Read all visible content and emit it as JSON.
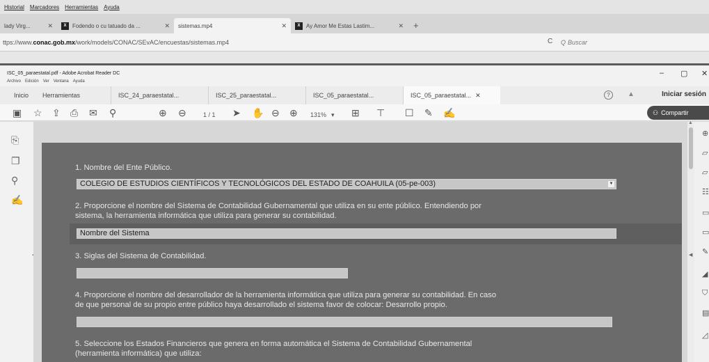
{
  "browser": {
    "menu": [
      "Historial",
      "Marcadores",
      "Herramientas",
      "Ayuda"
    ],
    "tabs": [
      {
        "label": "lady Virg...",
        "favicon": ""
      },
      {
        "label": "Fodendo o cu tatuado da ...",
        "favicon": "X"
      },
      {
        "label": "sistemas.mp4",
        "favicon": ""
      },
      {
        "label": "Ay Amor Me Estas Lastim...",
        "favicon": "X"
      }
    ],
    "url_prefix": "ttps://www.",
    "url_domain": "conac.gob.mx",
    "url_path": "/work/models/CONAC/SEvAC/encuestas/sistemas.mp4",
    "search_placeholder": "Buscar"
  },
  "acrobat": {
    "window_title": "ISC_05_paraestatal.pdf - Adobe Acrobat Reader DC",
    "menu": [
      "Archivo",
      "Edición",
      "Ver",
      "Ventana",
      "Ayuda"
    ],
    "nav": {
      "home": "Inicio",
      "tools": "Herramientas"
    },
    "doc_tabs": [
      {
        "label": "ISC_24_paraestatal..."
      },
      {
        "label": "ISC_25_paraestatal..."
      },
      {
        "label": "ISC_05_paraestatal..."
      },
      {
        "label": "ISC_05_paraestatal..."
      }
    ],
    "signin": "Iniciar sesión",
    "page_indicator": "1 / 1",
    "zoom": "131%",
    "share_label": "Compartir"
  },
  "form": {
    "q1": "1. Nombre del Ente Público.",
    "q1_value": "COLEGIO DE ESTUDIOS CIENTÍFICOS Y TECNOLÓGICOS DEL ESTADO DE COAHUILA (05-pe-003)",
    "q2_line1": "2. Proporcione el nombre del Sistema de Contabilidad Gubernamental que utiliza en su ente público. Entendiendo por",
    "q2_line2": "sistema, la herramienta informática que utiliza para generar su contabilidad.",
    "q2_value": "Nombre del Sistema",
    "q3": "3. Siglas del Sistema de Contabilidad.",
    "q4_line1": "4. Proporcione el nombre del desarrollador de la herramienta informática que utiliza para generar su contabilidad. En caso",
    "q4_line2": "de que personal de su propio entre público haya desarrollado el sistema favor de colocar: Desarrollo propio.",
    "q5_line1": "5. Seleccione los Estados Financieros que genera en forma automática el Sistema de Contabilidad Gubernamental",
    "q5_line2": "(herramienta informática) que utiliza:"
  }
}
